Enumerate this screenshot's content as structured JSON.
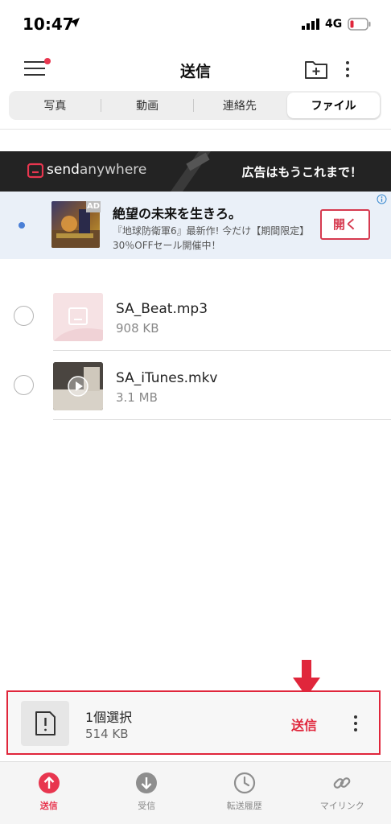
{
  "status_bar": {
    "time": "10:47",
    "network": "4G"
  },
  "header": {
    "title": "送信",
    "menu_icon": "hamburger-menu-icon",
    "folder_icon": "folder-add-icon",
    "more_icon": "more-vertical-icon"
  },
  "tabs": [
    {
      "label": "写真",
      "active": false
    },
    {
      "label": "動画",
      "active": false
    },
    {
      "label": "連絡先",
      "active": false
    },
    {
      "label": "ファイル",
      "active": true
    }
  ],
  "banner_ad": {
    "brand_bold": "send",
    "brand_light": "anywhere",
    "tagline": "広告はもうこれまで！"
  },
  "native_ad": {
    "badge": "AD",
    "title": "絶望の未来を生きろ。",
    "description": "『地球防衛軍6』最新作! 今だけ【期間限定】30％OFFセール開催中！",
    "cta": "開く"
  },
  "files": [
    {
      "name": "SA_Beat.mp3",
      "size": "908 KB",
      "type": "audio"
    },
    {
      "name": "SA_iTunes.mkv",
      "size": "3.1 MB",
      "type": "video"
    }
  ],
  "selection": {
    "count_label": "1個選択",
    "size": "514 KB",
    "send_label": "送信"
  },
  "bottom_nav": [
    {
      "label": "送信",
      "icon": "upload-icon",
      "active": true
    },
    {
      "label": "受信",
      "icon": "download-icon",
      "active": false
    },
    {
      "label": "転送履歴",
      "icon": "history-icon",
      "active": false
    },
    {
      "label": "マイリンク",
      "icon": "link-icon",
      "active": false
    }
  ],
  "colors": {
    "accent": "#e8364f",
    "highlight_border": "#e0263b",
    "banner_bg": "#232323",
    "ad_bg": "#eaf0f8"
  }
}
